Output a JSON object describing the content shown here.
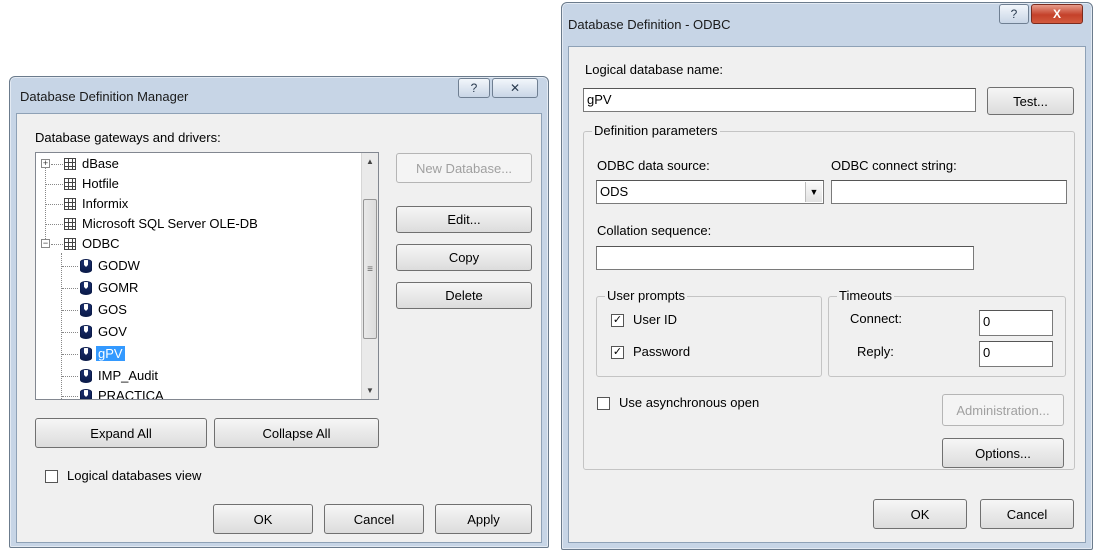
{
  "manager": {
    "title": "Database Definition Manager",
    "help_btn": "?",
    "close_btn": "✕",
    "gateways_label": "Database gateways and drivers:",
    "tree": [
      {
        "label": "dBase",
        "expander": "+",
        "icon": "grid-icon"
      },
      {
        "label": "Hotfile",
        "expander": "",
        "icon": "grid-icon"
      },
      {
        "label": "Informix",
        "expander": "",
        "icon": "grid-icon"
      },
      {
        "label": "Microsoft SQL Server OLE-DB",
        "expander": "",
        "icon": "grid-icon"
      },
      {
        "label": "ODBC",
        "expander": "−",
        "icon": "grid-icon"
      },
      {
        "label": "GODW",
        "icon": "database-icon"
      },
      {
        "label": "GOMR",
        "icon": "database-icon"
      },
      {
        "label": "GOS",
        "icon": "database-icon"
      },
      {
        "label": "GOV",
        "icon": "database-icon"
      },
      {
        "label": "gPV",
        "icon": "database-icon",
        "selected": true
      },
      {
        "label": "IMP_Audit",
        "icon": "database-icon"
      },
      {
        "label": "PRACTICA",
        "icon": "database-icon"
      }
    ],
    "buttons": {
      "new_database": "New Database...",
      "edit": "Edit...",
      "copy": "Copy",
      "delete": "Delete",
      "expand_all": "Expand All",
      "collapse_all": "Collapse All",
      "ok": "OK",
      "cancel": "Cancel",
      "apply": "Apply"
    },
    "logical_view_label": "Logical databases view",
    "logical_view_checked": false
  },
  "odbc": {
    "title": "Database Definition - ODBC",
    "help_btn": "?",
    "close_btn": "X",
    "logical_name_label": "Logical database name:",
    "logical_name_value": "gPV",
    "test_button": "Test...",
    "definition_group": "Definition parameters",
    "data_source_label": "ODBC data source:",
    "data_source_value": "ODS",
    "connect_string_label": "ODBC connect string:",
    "connect_string_value": "",
    "collation_label": "Collation sequence:",
    "collation_value": "",
    "user_prompts_group": "User prompts",
    "user_id_label": "User ID",
    "user_id_checked": true,
    "password_label": "Password",
    "password_checked": true,
    "timeouts_group": "Timeouts",
    "connect_label": "Connect:",
    "connect_value": "0",
    "reply_label": "Reply:",
    "reply_value": "0",
    "async_label": "Use asynchronous open",
    "async_checked": false,
    "administration_button": "Administration...",
    "options_button": "Options...",
    "ok_button": "OK",
    "cancel_button": "Cancel",
    "check_mark": "✓"
  }
}
